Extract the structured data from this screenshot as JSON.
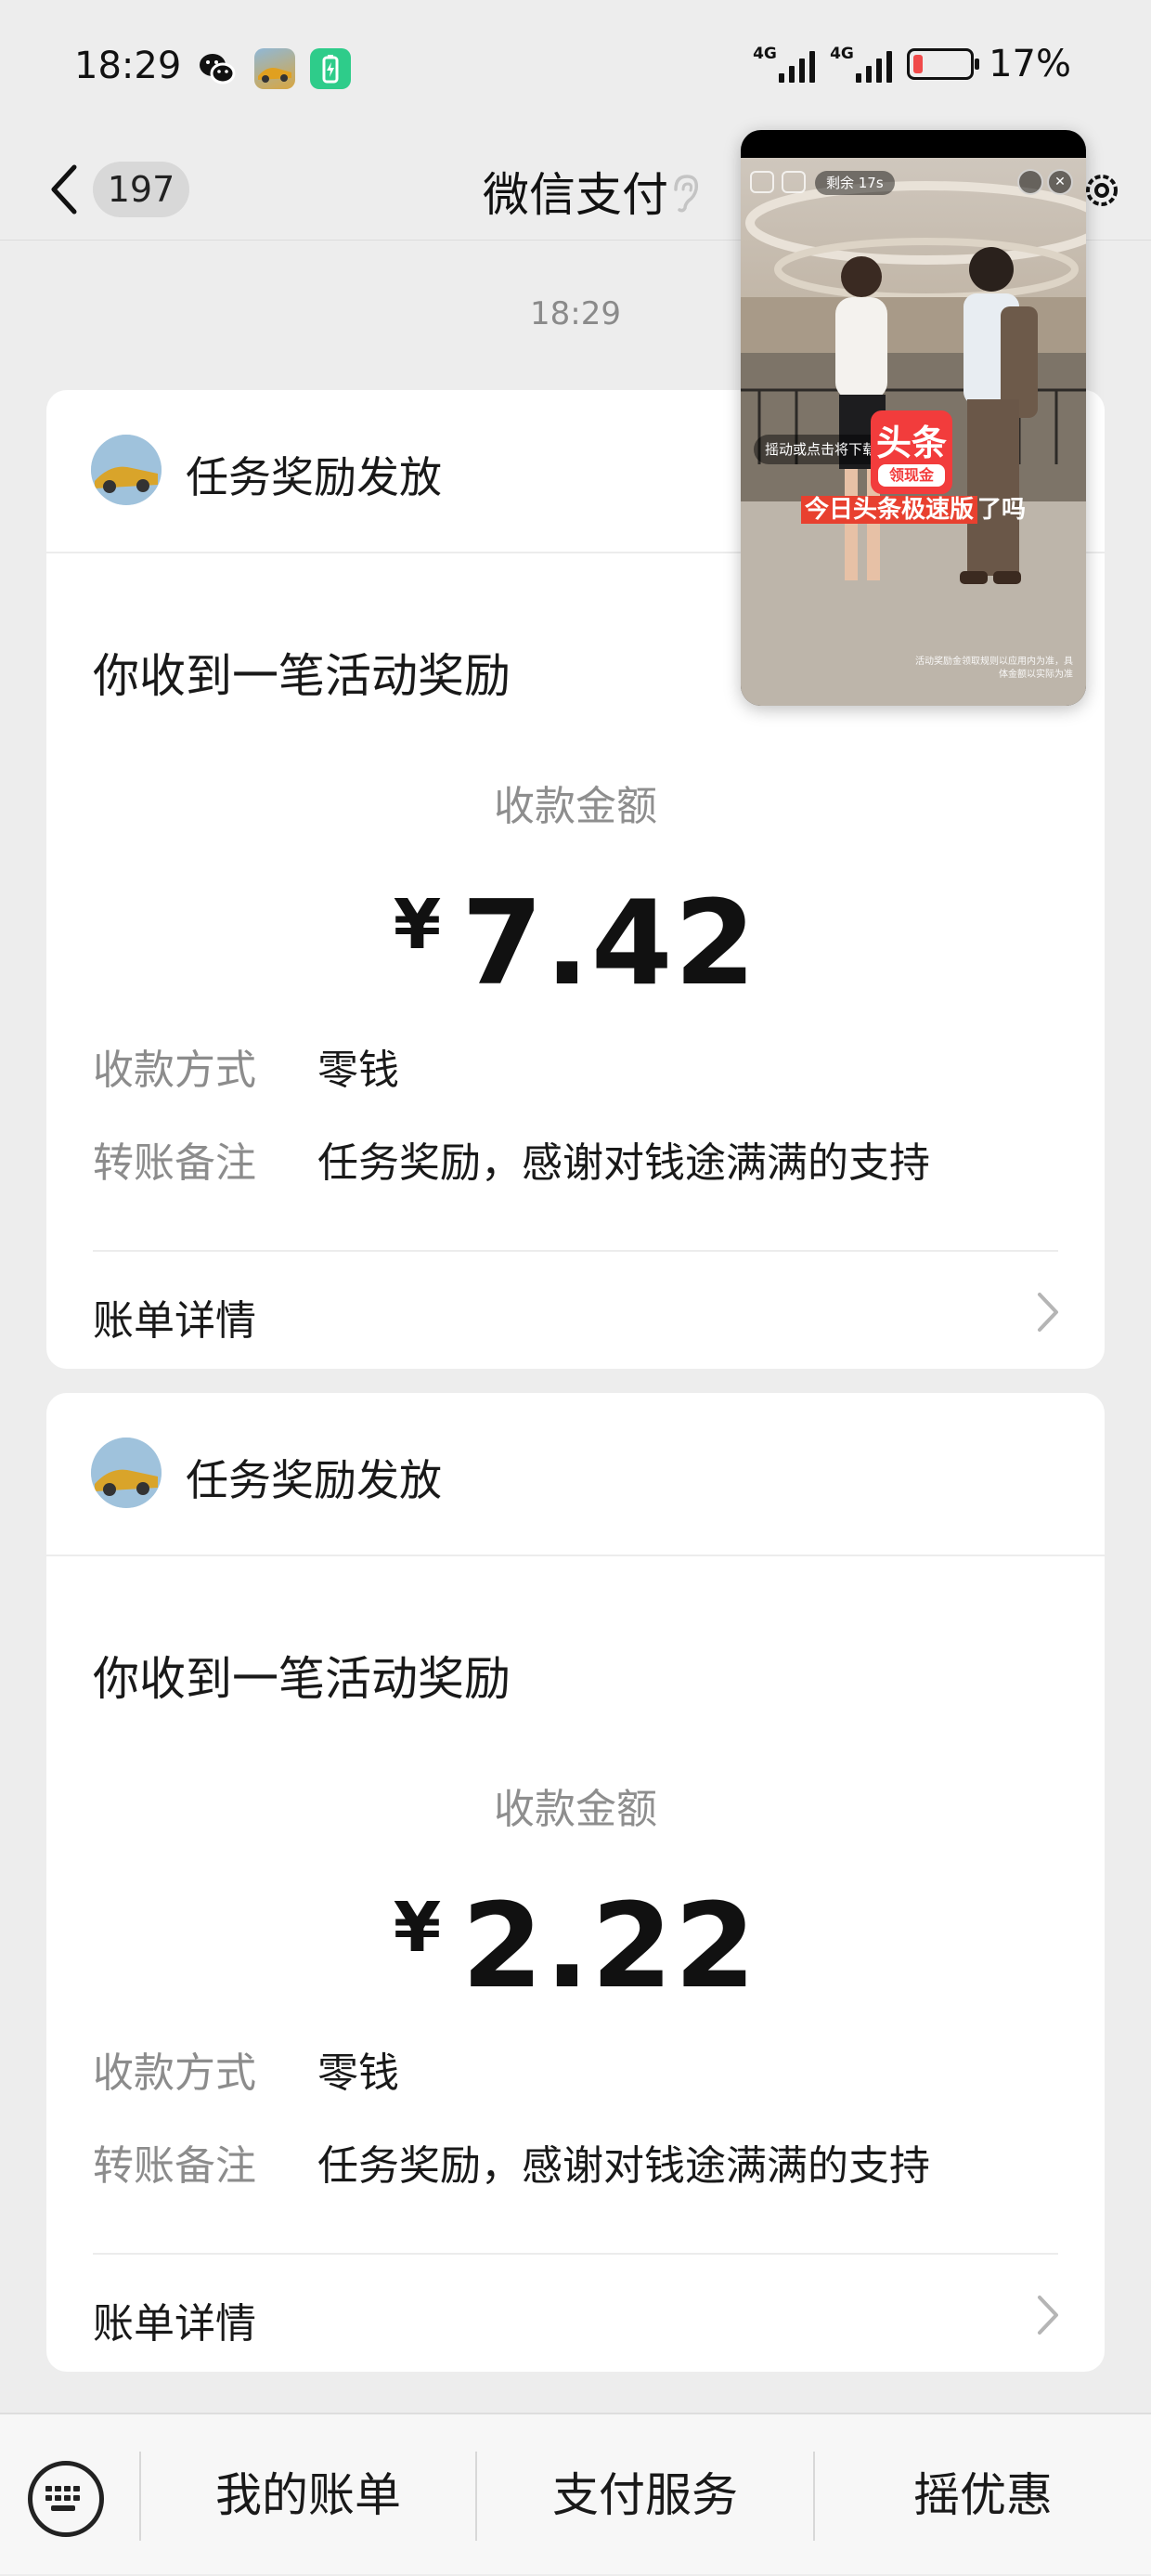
{
  "status_bar": {
    "time": "18:29",
    "apps": [
      "wechat-icon",
      "game-icon",
      "battery-saver-icon"
    ],
    "network_1": "4G",
    "network_2": "4G",
    "battery": "17%",
    "battery_level": 0.17,
    "battery_color": "#f04a4a"
  },
  "nav": {
    "unread_count": "197",
    "title": "微信支付",
    "back_icon": "chevron-left-icon",
    "voice_icon": "ear-icon",
    "settings_icon": "gear-icon"
  },
  "chat": {
    "timestamp": "18:29",
    "cards": [
      {
        "sender": "任务奖励发放",
        "heading": "你收到一笔活动奖励",
        "amount_label": "收款金额",
        "currency": "¥",
        "amount": "7.42",
        "method_label": "收款方式",
        "method_value": "零钱",
        "note_label": "转账备注",
        "note_value": "任务奖励，感谢对钱途满满的支持",
        "detail_label": "账单详情"
      },
      {
        "sender": "任务奖励发放",
        "heading": "你收到一笔活动奖励",
        "amount_label": "收款金额",
        "currency": "¥",
        "amount": "2.22",
        "method_label": "收款方式",
        "method_value": "零钱",
        "note_label": "转账备注",
        "note_value": "任务奖励，感谢对钱途满满的支持",
        "detail_label": "账单详情"
      }
    ]
  },
  "floating_video": {
    "remaining": "剩余 17s",
    "close_icon": "close-icon",
    "hint": "摇动或点击将下载应用",
    "logo_top": "头条",
    "logo_bottom": "领现金",
    "caption_highlight": "今日头条极速版",
    "caption_tail": "了吗",
    "fine_print": "活动奖励金领取规则以应用内为准，具体金额以实际为准",
    "accent": "#f23c3c"
  },
  "bottom_bar": {
    "keyboard_icon": "keyboard-icon",
    "tabs": [
      "我的账单",
      "支付服务",
      "摇优惠"
    ]
  }
}
